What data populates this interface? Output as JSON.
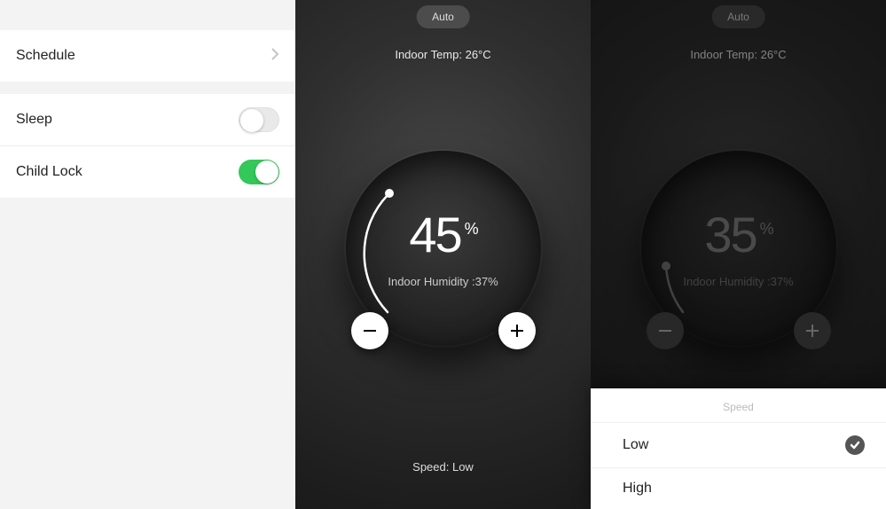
{
  "settings": {
    "schedule_label": "Schedule",
    "sleep_label": "Sleep",
    "childlock_label": "Child Lock",
    "sleep_on": false,
    "childlock_on": true
  },
  "device_a": {
    "mode": "Auto",
    "indoor_temp": "Indoor Temp: 26°C",
    "target": "45",
    "pct": "%",
    "humidity": "Indoor Humidity :37%",
    "speed_line": "Speed: Low"
  },
  "device_b": {
    "mode": "Auto",
    "indoor_temp": "Indoor Temp: 26°C",
    "target": "35",
    "pct": "%",
    "humidity": "Indoor Humidity :37%"
  },
  "sheet": {
    "title": "Speed",
    "options": [
      "Low",
      "High"
    ],
    "selected": "Low"
  }
}
